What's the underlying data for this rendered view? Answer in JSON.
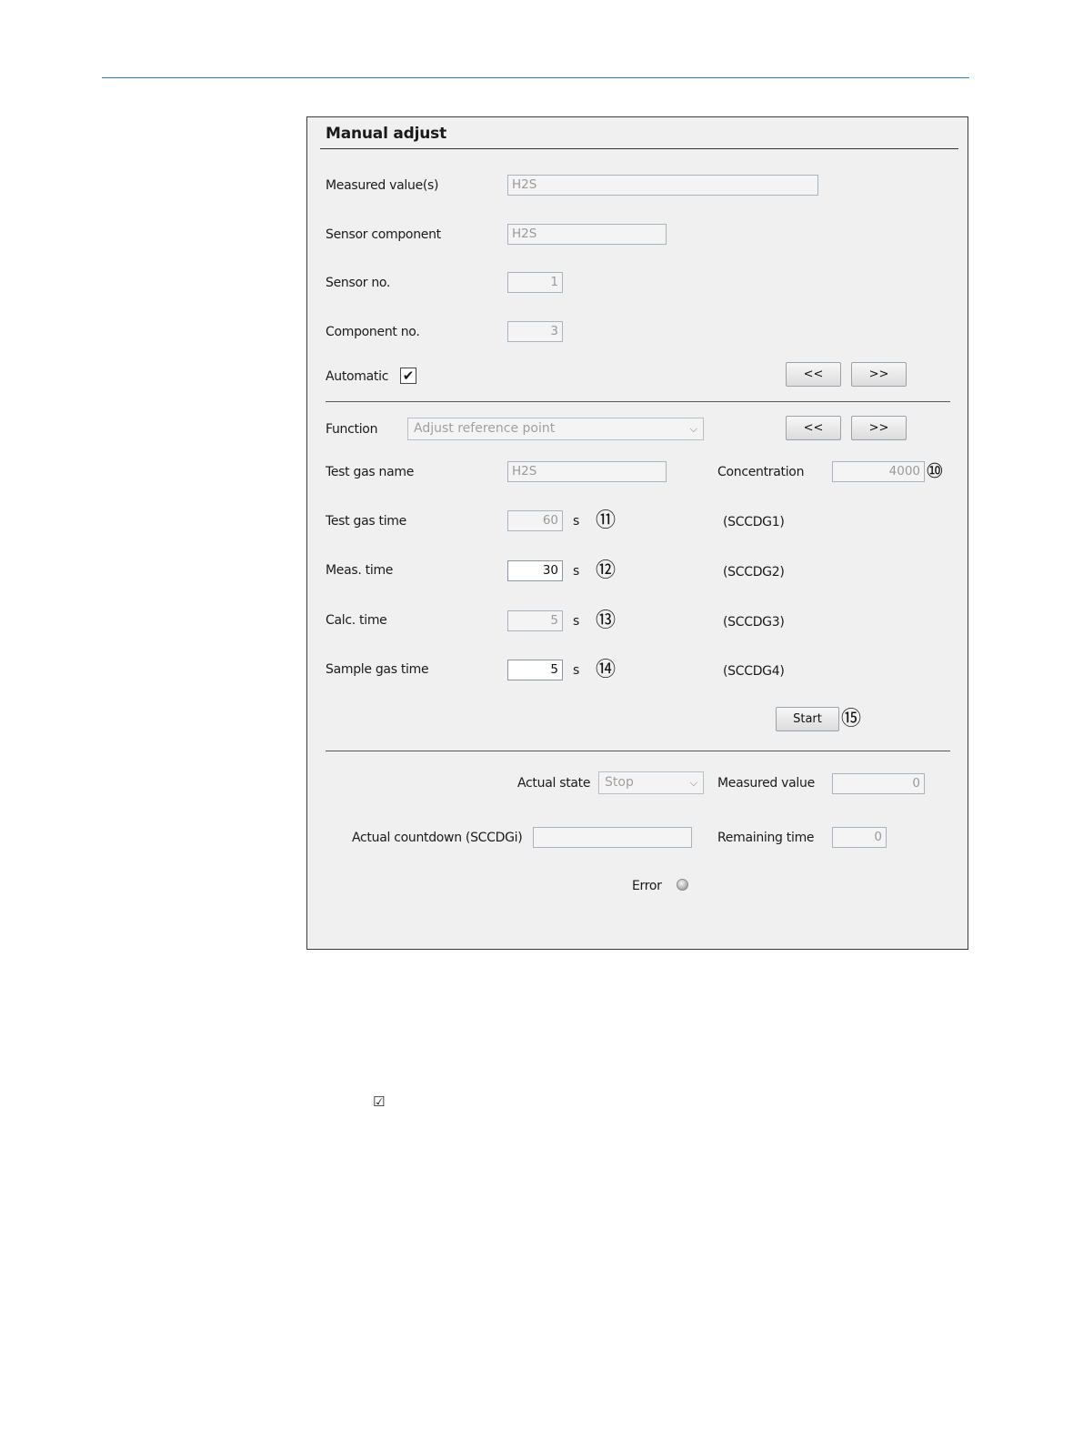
{
  "dialog": {
    "title": "Manual adjust"
  },
  "identification": {
    "measured_values_label": "Measured value(s)",
    "measured_values": "H2S",
    "sensor_component_label": "Sensor component",
    "sensor_component": "H2S",
    "sensor_no_label": "Sensor no.",
    "sensor_no": "1",
    "component_no_label": "Component no.",
    "component_no": "3",
    "automatic_label": "Automatic",
    "automatic_checked": true,
    "check_mark": "✔",
    "prev_label": "<<",
    "next_label": ">>"
  },
  "function": {
    "label": "Function",
    "selected": "Adjust reference point",
    "prev_label": "<<",
    "next_label": ">>",
    "test_gas_name_label": "Test gas name",
    "test_gas_name": "H2S",
    "concentration_label": "Concentration",
    "concentration": "4000",
    "marker_10": "⑩",
    "rows": [
      {
        "label": "Test gas time",
        "value": "60",
        "unit": "s",
        "marker": "⑪",
        "code": "(SCCDG1)"
      },
      {
        "label": "Meas. time",
        "value": "30",
        "unit": "s",
        "marker": "⑫",
        "code": "(SCCDG2)"
      },
      {
        "label": "Calc. time",
        "value": "5",
        "unit": "s",
        "marker": "⑬",
        "code": "(SCCDG3)"
      },
      {
        "label": "Sample gas time",
        "value": "5",
        "unit": "s",
        "marker": "⑭",
        "code": "(SCCDG4)"
      }
    ],
    "start_label": "Start",
    "marker_15": "⑮"
  },
  "status": {
    "actual_state_label": "Actual state",
    "actual_state": "Stop",
    "measured_value_label": "Measured value",
    "measured_value": "0",
    "countdown_label": "Actual countdown (SCCDGi)",
    "countdown_value": "",
    "remaining_time_label": "Remaining time",
    "remaining_time": "0",
    "error_label": "Error"
  },
  "footer": {
    "checkbox_symbol": "☑"
  }
}
